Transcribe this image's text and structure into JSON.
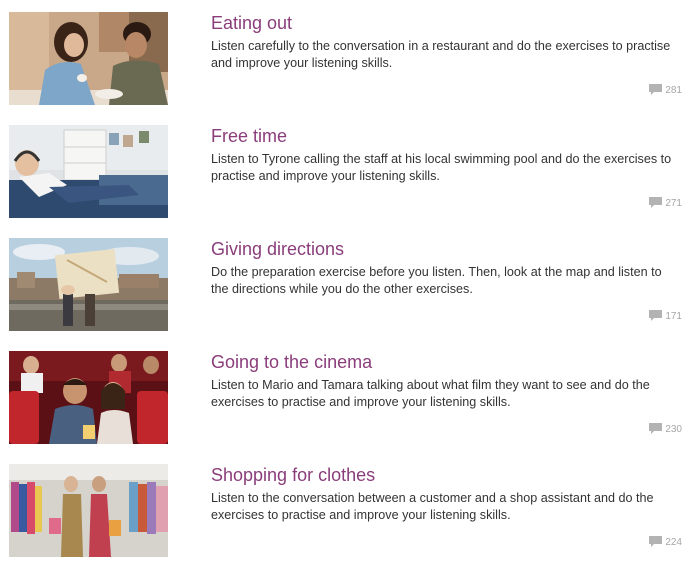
{
  "lessons": [
    {
      "title": "Eating out",
      "description": "Listen carefully to the conversation in a restaurant and do the exercises to practise and improve your listening skills.",
      "comment_count": "281",
      "image_icon": "restaurant-photo"
    },
    {
      "title": "Free time",
      "description": "Listen to Tyrone calling the staff at his local swimming pool and do the exercises to practise and improve your listening skills.",
      "comment_count": "271",
      "image_icon": "boy-with-headphones-photo"
    },
    {
      "title": "Giving directions",
      "description": "Do the preparation exercise before you listen. Then, look at the map and listen to the directions while you do the other exercises.",
      "comment_count": "171",
      "image_icon": "people-with-map-photo"
    },
    {
      "title": "Going to the cinema",
      "description": "Listen to Mario and Tamara talking about what film they want to see and do the exercises to practise and improve your listening skills.",
      "comment_count": "230",
      "image_icon": "cinema-audience-photo"
    },
    {
      "title": "Shopping for clothes",
      "description": "Listen to the conversation between a customer and a shop assistant and do the exercises to practise and improve your listening skills.",
      "comment_count": "224",
      "image_icon": "clothes-shopping-photo"
    }
  ],
  "colors": {
    "title": "#8a3d7a",
    "description": "#333333",
    "comment_icon": "#b3b3b3",
    "comment_count": "#a6a6a6"
  },
  "comment_icon": "speech-bubble-icon"
}
